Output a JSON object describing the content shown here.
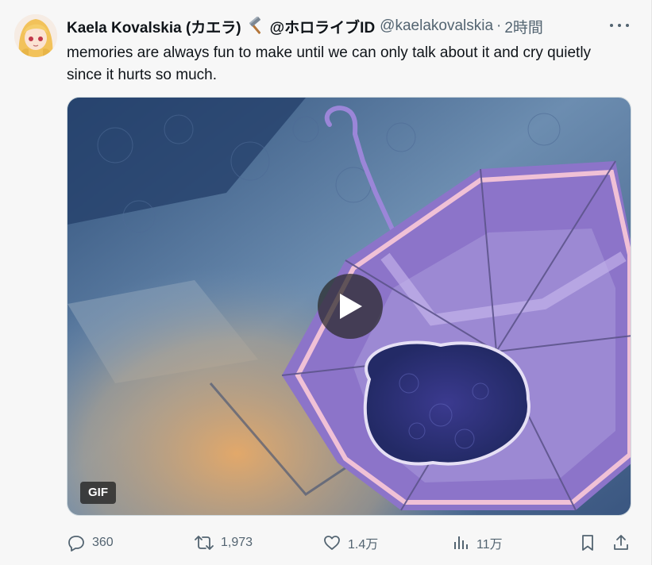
{
  "tweet": {
    "display_name": "Kaela Kovalskia (カエラ)",
    "handle_name": "@ホロライブID",
    "handle": "@kaelakovalskia",
    "separator": "·",
    "time": "2時間",
    "text": "memories are always fun to make until we can only talk about it and cry quietly since it hurts so much."
  },
  "media": {
    "badge": "GIF"
  },
  "actions": {
    "reply_count": "360",
    "retweet_count": "1,973",
    "like_count": "1.4万",
    "view_count": "11万"
  },
  "icons": {
    "more": "more-dots-icon",
    "reply": "reply-bubble-icon",
    "retweet": "retweet-icon",
    "like": "heart-icon",
    "views": "bar-chart-icon",
    "bookmark": "bookmark-icon",
    "share": "share-icon",
    "play": "play-icon",
    "hammer": "hammer-emoji-icon"
  },
  "colors": {
    "text": "#0f1419",
    "secondary": "#536471",
    "background": "#f7f7f7"
  }
}
